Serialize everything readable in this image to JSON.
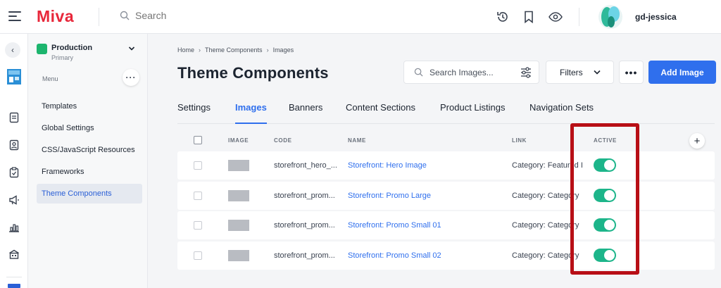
{
  "app": {
    "logo": "Miva",
    "username": "gd-jessica"
  },
  "colors": {
    "brand": "#e8273a",
    "accent": "#2f6fed",
    "toggle_on": "#1db58a",
    "highlight": "#b80f16",
    "store_swatch": "#1db56e"
  },
  "topbar": {
    "search_placeholder": "Search",
    "icons": [
      "menu-icon",
      "search-icon",
      "history-icon",
      "bookmark-icon",
      "eye-icon"
    ]
  },
  "rail": {
    "icons": [
      "chevron-left-icon",
      "store-icon",
      "orders-icon",
      "customers-icon",
      "clipboard-icon",
      "megaphone-icon",
      "chart-icon",
      "building-icon"
    ]
  },
  "sidebar": {
    "store_name": "Production",
    "store_sub": "Primary",
    "menu_label": "Menu",
    "items": [
      {
        "label": "Templates"
      },
      {
        "label": "Global Settings"
      },
      {
        "label": "CSS/JavaScript Resources"
      },
      {
        "label": "Frameworks"
      },
      {
        "label": "Theme Components",
        "active": true
      }
    ]
  },
  "breadcrumb": [
    "Home",
    "Theme Components",
    "Images"
  ],
  "page": {
    "title": "Theme Components"
  },
  "toolbar": {
    "search_placeholder": "Search Images...",
    "filters_label": "Filters",
    "more_label": "•••",
    "add_label": "Add Image"
  },
  "tabs": [
    {
      "label": "Settings"
    },
    {
      "label": "Images",
      "active": true
    },
    {
      "label": "Banners"
    },
    {
      "label": "Content Sections"
    },
    {
      "label": "Product Listings"
    },
    {
      "label": "Navigation Sets"
    }
  ],
  "table": {
    "headers": {
      "image": "IMAGE",
      "code": "CODE",
      "name": "NAME",
      "link": "LINK",
      "active": "ACTIVE"
    },
    "rows": [
      {
        "code": "storefront_hero_...",
        "name": "Storefront: Hero Image",
        "link": "Category: Featured I",
        "active": true
      },
      {
        "code": "storefront_prom...",
        "name": "Storefront: Promo Large",
        "link": "Category: Category",
        "active": true
      },
      {
        "code": "storefront_prom...",
        "name": "Storefront: Promo Small 01",
        "link": "Category: Category",
        "active": true
      },
      {
        "code": "storefront_prom...",
        "name": "Storefront: Promo Small 02",
        "link": "Category: Category",
        "active": true
      }
    ]
  }
}
